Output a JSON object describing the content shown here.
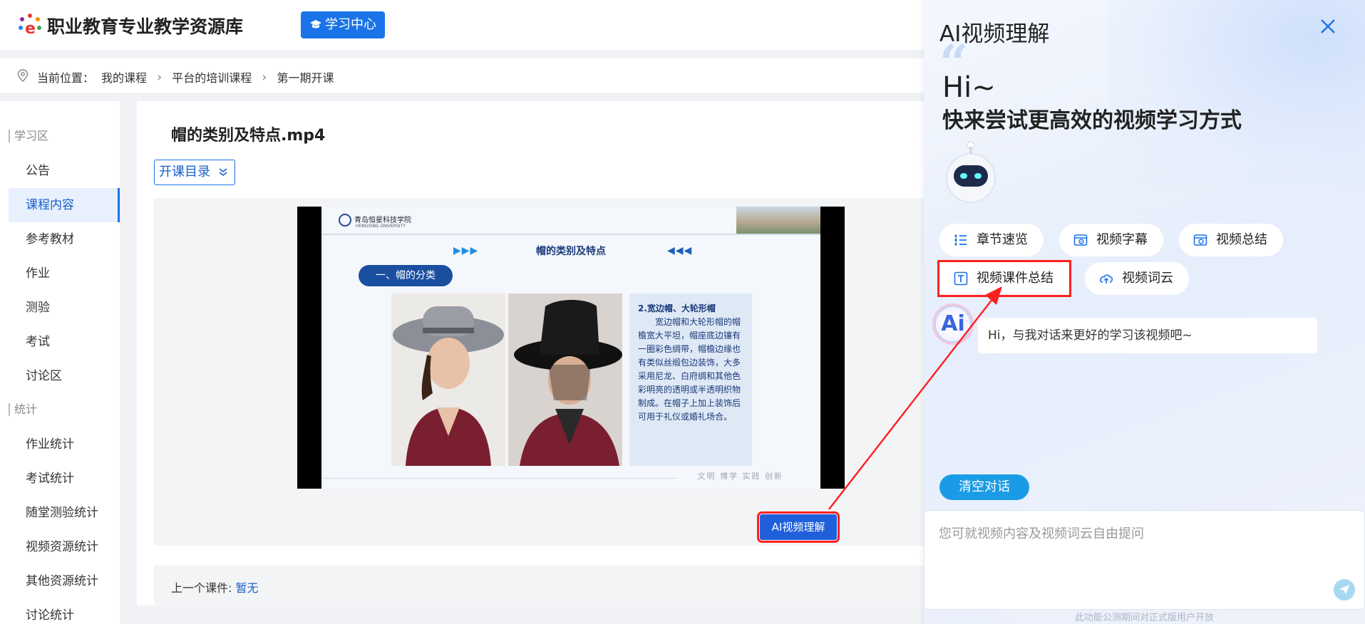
{
  "header": {
    "site_title": "职业教育专业教学资源库",
    "learn_center_label": "学习中心"
  },
  "breadcrumb": {
    "prefix": "当前位置：",
    "items": [
      "我的课程",
      "平台的培训课程",
      "第一期开课"
    ]
  },
  "sidebar": {
    "groups": [
      {
        "label": "学习区",
        "items": [
          "公告",
          "课程内容",
          "参考教材",
          "作业",
          "测验",
          "考试",
          "讨论区"
        ]
      },
      {
        "label": "统计",
        "items": [
          "作业统计",
          "考试统计",
          "随堂测验统计",
          "视频资源统计",
          "其他资源统计",
          "讨论统计"
        ]
      }
    ],
    "active_item": "课程内容"
  },
  "main": {
    "video_title": "帽的类别及特点.mp4",
    "catalog_label": "开课目录",
    "ai_video_button": "AI视频理解",
    "prev_label": "上一个课件:",
    "prev_value": "暂无"
  },
  "slide": {
    "school_name": "青岛恒星科技学院",
    "school_sub": "HENGXING UNIVERSITY",
    "heading": "帽的类别及特点",
    "pill": "一、帽的分类",
    "text_head": "2.宽边帽、大轮形帽",
    "text_body": "宽边帽和大轮形帽的帽檐宽大平坦，帽座底边镶有一圈彩色绸带，帽檐边缘也有类似丝缎包边装饰，大多采用尼龙、白府绸和其他色彩明亮的透明或半透明织物制成。在帽子上加上装饰后可用于礼仪或婚礼场合。",
    "footer_motto": "文明 博学 实践 创新"
  },
  "ai_panel": {
    "title": "AI视频理解",
    "greeting": "Hi~",
    "subtitle": "快来尝试更高效的视频学习方式",
    "chips_row1": [
      {
        "label": "章节速览",
        "icon": "list-icon"
      },
      {
        "label": "视频字幕",
        "icon": "subtitle-icon"
      },
      {
        "label": "视频总结",
        "icon": "summary-icon"
      }
    ],
    "chips_row2": [
      {
        "label": "视频课件总结",
        "icon": "text-icon"
      },
      {
        "label": "视频词云",
        "icon": "cloud-upload-icon"
      }
    ],
    "avatar_label": "Ai",
    "bot_message": "Hi，与我对话来更好的学习该视频吧~",
    "clear_label": "清空对话",
    "input_placeholder": "您可就视频内容及视频词云自由提问",
    "footnote": "此功能公测期间对正式版用户开放"
  },
  "colors": {
    "primary": "#1a73e8",
    "highlight": "#ff1f1f",
    "clear_button": "#1a9be6"
  }
}
